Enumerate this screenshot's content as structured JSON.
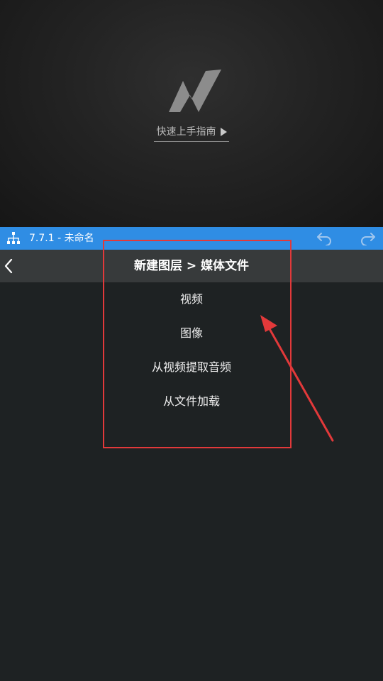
{
  "preview": {
    "guide_label": "快速上手指南"
  },
  "project_bar": {
    "title": "7.7.1 - 未命名",
    "layers_icon": "layers-hierarchy-icon",
    "undo_icon": "undo-icon",
    "redo_icon": "redo-icon"
  },
  "panel": {
    "title": "新建图层 > 媒体文件",
    "back_icon": "chevron-left-icon"
  },
  "menu": {
    "items": [
      {
        "label": "视频"
      },
      {
        "label": "图像"
      },
      {
        "label": "从视频提取音频"
      },
      {
        "label": "从文件加载"
      }
    ]
  },
  "colors": {
    "accent_blue": "#2f8de4",
    "annotation_red": "#e2393a",
    "background": "#1e2223",
    "header_bg": "#373a3b"
  }
}
